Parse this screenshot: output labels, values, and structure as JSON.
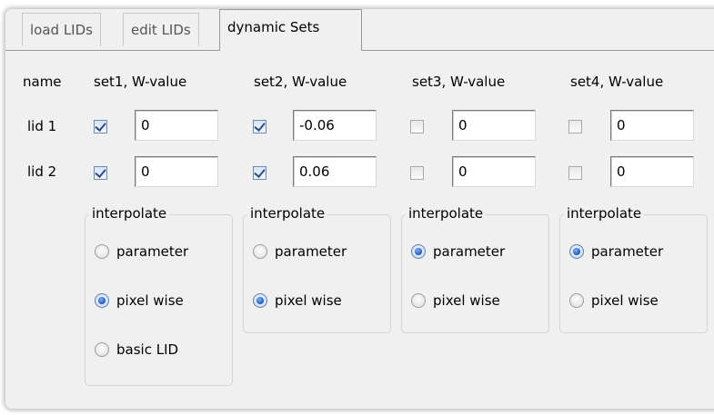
{
  "tabs": [
    {
      "label": "load LIDs"
    },
    {
      "label": "edit LIDs"
    },
    {
      "label": "dynamic Sets"
    }
  ],
  "header": {
    "name": "name",
    "sets": [
      "set1, W-value",
      "set2, W-value",
      "set3, W-value",
      "set4, W-value"
    ]
  },
  "rows": [
    {
      "label": "lid 1",
      "checked": [
        true,
        true,
        false,
        false
      ],
      "values": [
        "0",
        "-0.06",
        "0",
        "0"
      ]
    },
    {
      "label": "lid 2",
      "checked": [
        true,
        true,
        false,
        false
      ],
      "values": [
        "0",
        "0.06",
        "0",
        "0"
      ]
    }
  ],
  "groups": [
    {
      "title": "interpolate",
      "options": [
        {
          "label": "parameter",
          "selected": false
        },
        {
          "label": "pixel wise",
          "selected": true
        },
        {
          "label": "basic LID",
          "selected": false
        }
      ]
    },
    {
      "title": "interpolate",
      "options": [
        {
          "label": "parameter",
          "selected": false
        },
        {
          "label": "pixel wise",
          "selected": true
        }
      ]
    },
    {
      "title": "interpolate",
      "options": [
        {
          "label": "parameter",
          "selected": true
        },
        {
          "label": "pixel wise",
          "selected": false
        }
      ]
    },
    {
      "title": "interpolate",
      "options": [
        {
          "label": "parameter",
          "selected": true
        },
        {
          "label": "pixel wise",
          "selected": false
        }
      ]
    }
  ]
}
